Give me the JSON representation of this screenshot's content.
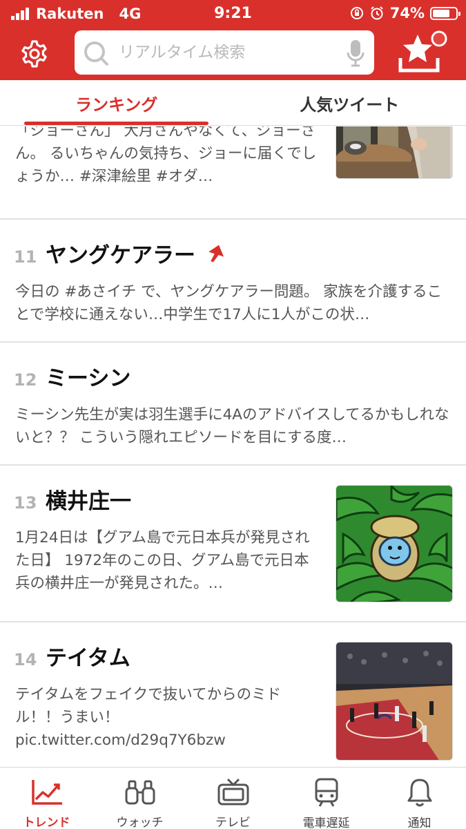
{
  "colors": {
    "brand": "#d9302c",
    "text": "#111111",
    "muted": "#555555",
    "rank": "#b3b3b3"
  },
  "status_bar": {
    "carrier": "Rakuten",
    "network": "4G",
    "time": "9:21",
    "battery": "74%",
    "battery_level": 0.74
  },
  "search": {
    "placeholder": "リアルタイム検索",
    "value": ""
  },
  "tabs": [
    {
      "label": "ランキング",
      "active": true
    },
    {
      "label": "人気ツイート",
      "active": false
    }
  ],
  "trends": [
    {
      "rank": "",
      "name": "",
      "desc": "「ジョーさん」 大月さんやなくて、ジョーさん。 るいちゃんの気持ち、ジョーに届くでしょうか… #深津絵里 #オダ…",
      "thumb": "drama-scene"
    },
    {
      "rank": "11",
      "name": "ヤングケアラー",
      "trending_up": true,
      "desc": "今日の #あさイチ で、ヤングケアラー問題。 家族を介護することで学校に通えない…中学生で17人に1人がこの状…"
    },
    {
      "rank": "12",
      "name": "ミーシン",
      "desc": "ミーシン先生が実は羽生選手に4Aのアドバイスしてるかもしれないと？？ こういう隠れエピソードを目にする度…"
    },
    {
      "rank": "13",
      "name": "横井庄一",
      "desc": "1月24日は【グアム島で元日本兵が発見された日】 1972年のこの日、グアム島で元日本兵の横井庄一が発見された。…",
      "thumb": "jungle-illustration"
    },
    {
      "rank": "14",
      "name": "テイタム",
      "desc": "テイタムをフェイクで抜いてからのミドル！！うまい！ pic.twitter.com/d29q7Y6bzw",
      "thumb": "basketball-court"
    }
  ],
  "bottom_nav": [
    {
      "label": "トレンド",
      "icon": "trend-chart-icon",
      "active": true
    },
    {
      "label": "ウォッチ",
      "icon": "binoculars-icon",
      "active": false
    },
    {
      "label": "テレビ",
      "icon": "tv-icon",
      "active": false
    },
    {
      "label": "電車遅延",
      "icon": "train-icon",
      "active": false
    },
    {
      "label": "通知",
      "icon": "bell-icon",
      "active": false
    }
  ]
}
